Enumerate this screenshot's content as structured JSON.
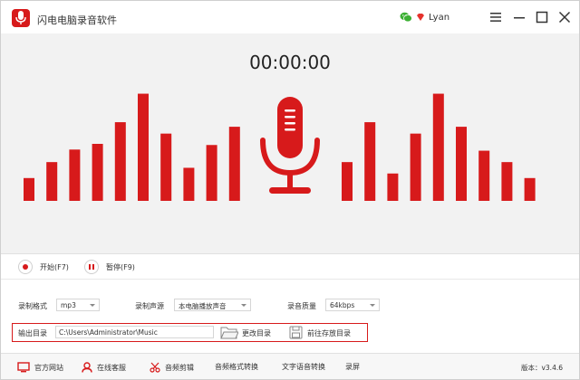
{
  "app": {
    "title": "闪电电脑录音软件",
    "user": "Lyan"
  },
  "timer": "00:00:00",
  "bars": {
    "color": "#d71a1b",
    "left_levels": [
      0.2,
      0.34,
      0.45,
      0.5,
      0.69,
      0.94,
      0.59,
      0.29,
      0.49,
      0.65
    ],
    "right_levels": [
      0.34,
      0.69,
      0.24,
      0.59,
      0.94,
      0.65,
      0.44,
      0.34,
      0.2
    ]
  },
  "controls": {
    "start": "开始(F7)",
    "pause": "暂停(F9)"
  },
  "settings": {
    "format_label": "录制格式",
    "format_value": "mp3",
    "source_label": "录制声源",
    "source_value": "本电脑播放声音",
    "quality_label": "录音质量",
    "quality_value": "64kbps",
    "output_label": "输出目录",
    "output_value": "C:\\Users\\Administrator\\Music",
    "change_dir": "更改目录",
    "open_dir": "前往存放目录"
  },
  "bottom": {
    "items": [
      "官方网站",
      "在线客服",
      "音频剪辑",
      "音频格式转换",
      "文字语音转换",
      "录屏"
    ],
    "version": "版本：v3.4.6"
  },
  "colors": {
    "accent": "#d71a1b",
    "wechat": "#3cb034"
  }
}
